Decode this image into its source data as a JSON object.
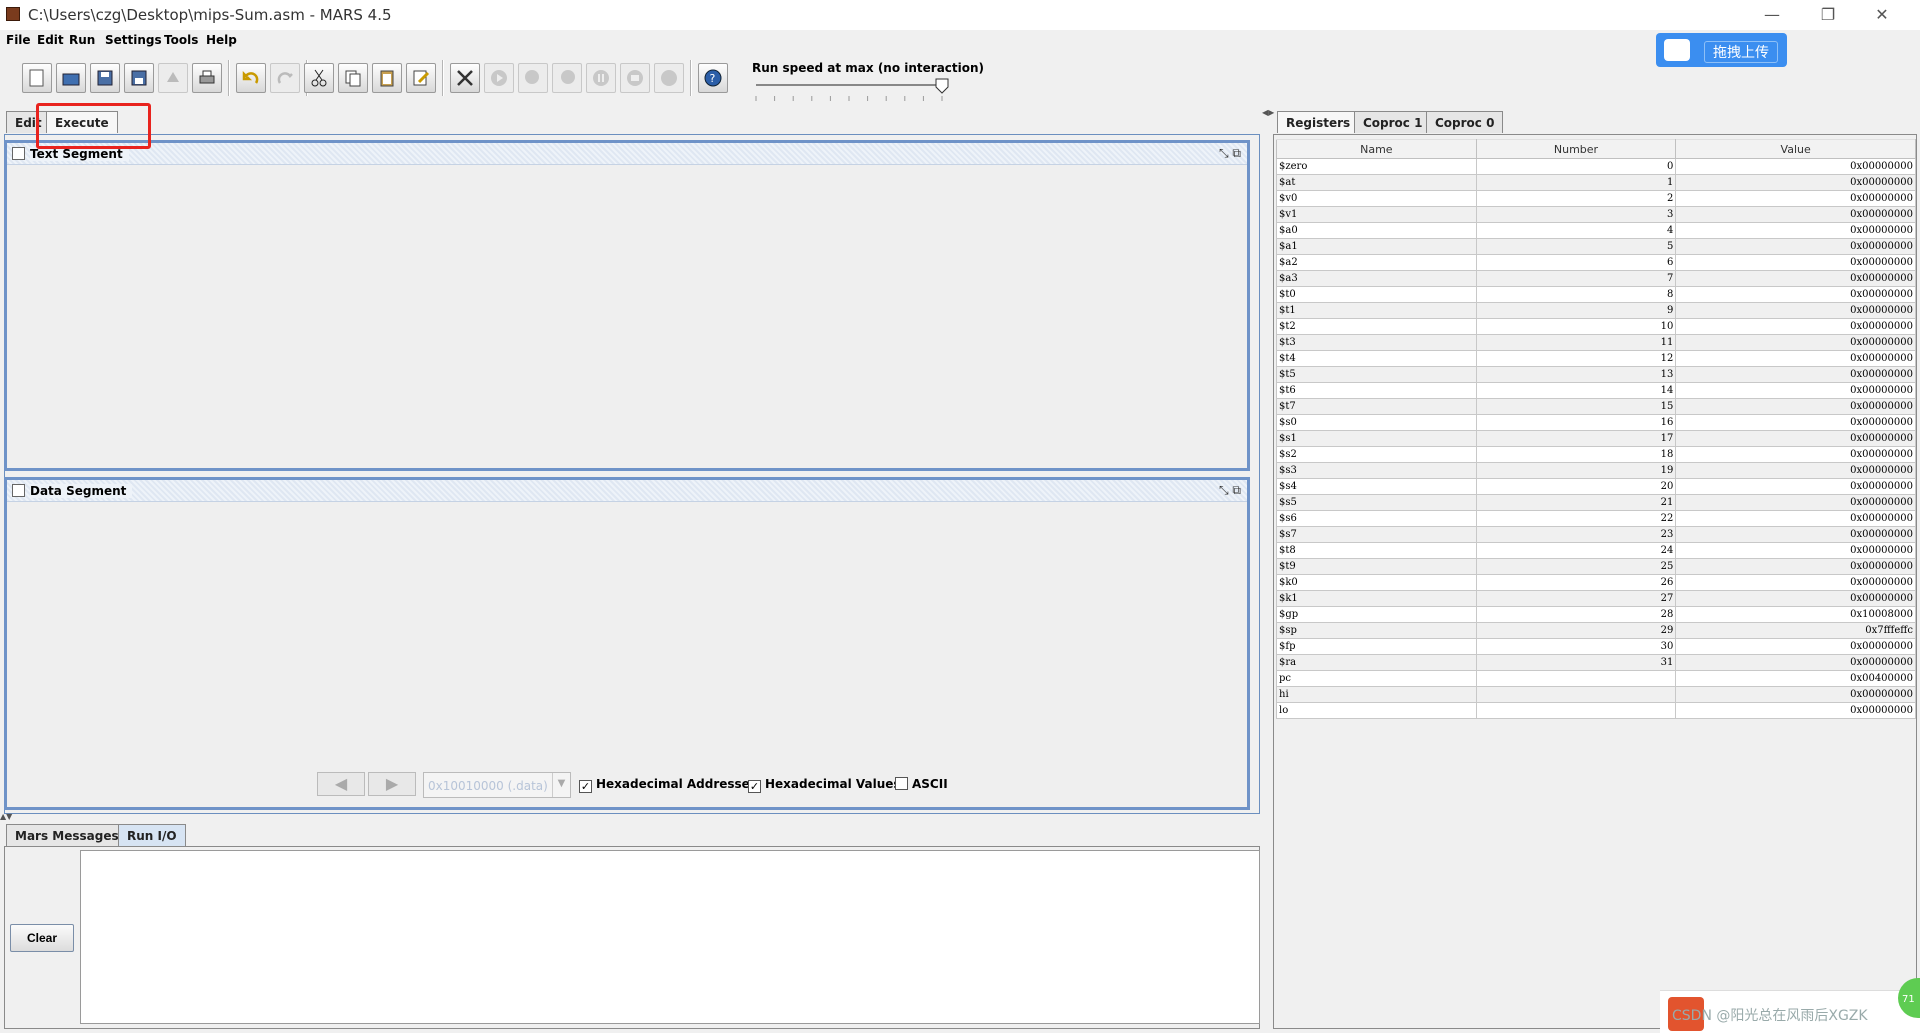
{
  "window": {
    "title": "C:\\Users\\czg\\Desktop\\mips-Sum.asm  - MARS 4.5",
    "min": "—",
    "max": "❐",
    "close": "✕"
  },
  "menu": [
    "File",
    "Edit",
    "Run",
    "Settings",
    "Tools",
    "Help"
  ],
  "toolbar": {
    "speed_label": "Run speed at max (no interaction)",
    "speed_percent": 100
  },
  "upload_button": "拖拽上传",
  "editor_tabs": [
    "Edit",
    "Execute"
  ],
  "text_segment": {
    "title": "Text Segment"
  },
  "data_segment": {
    "title": "Data Segment",
    "address": "0x10010000 (.data)",
    "hex_addresses": "Hexadecimal Addresses",
    "hex_values": "Hexadecimal Values",
    "ascii": "ASCII"
  },
  "message_tabs": [
    "Mars Messages",
    "Run I/O"
  ],
  "clear_label": "Clear",
  "register_tabs": [
    "Registers",
    "Coproc 1",
    "Coproc 0"
  ],
  "register_headers": [
    "Name",
    "Number",
    "Value"
  ],
  "registers": [
    [
      "$zero",
      "0",
      "0x00000000"
    ],
    [
      "$at",
      "1",
      "0x00000000"
    ],
    [
      "$v0",
      "2",
      "0x00000000"
    ],
    [
      "$v1",
      "3",
      "0x00000000"
    ],
    [
      "$a0",
      "4",
      "0x00000000"
    ],
    [
      "$a1",
      "5",
      "0x00000000"
    ],
    [
      "$a2",
      "6",
      "0x00000000"
    ],
    [
      "$a3",
      "7",
      "0x00000000"
    ],
    [
      "$t0",
      "8",
      "0x00000000"
    ],
    [
      "$t1",
      "9",
      "0x00000000"
    ],
    [
      "$t2",
      "10",
      "0x00000000"
    ],
    [
      "$t3",
      "11",
      "0x00000000"
    ],
    [
      "$t4",
      "12",
      "0x00000000"
    ],
    [
      "$t5",
      "13",
      "0x00000000"
    ],
    [
      "$t6",
      "14",
      "0x00000000"
    ],
    [
      "$t7",
      "15",
      "0x00000000"
    ],
    [
      "$s0",
      "16",
      "0x00000000"
    ],
    [
      "$s1",
      "17",
      "0x00000000"
    ],
    [
      "$s2",
      "18",
      "0x00000000"
    ],
    [
      "$s3",
      "19",
      "0x00000000"
    ],
    [
      "$s4",
      "20",
      "0x00000000"
    ],
    [
      "$s5",
      "21",
      "0x00000000"
    ],
    [
      "$s6",
      "22",
      "0x00000000"
    ],
    [
      "$s7",
      "23",
      "0x00000000"
    ],
    [
      "$t8",
      "24",
      "0x00000000"
    ],
    [
      "$t9",
      "25",
      "0x00000000"
    ],
    [
      "$k0",
      "26",
      "0x00000000"
    ],
    [
      "$k1",
      "27",
      "0x00000000"
    ],
    [
      "$gp",
      "28",
      "0x10008000"
    ],
    [
      "$sp",
      "29",
      "0x7fffeffc"
    ],
    [
      "$fp",
      "30",
      "0x00000000"
    ],
    [
      "$ra",
      "31",
      "0x00000000"
    ],
    [
      "pc",
      "",
      "0x00400000"
    ],
    [
      "hi",
      "",
      "0x00000000"
    ],
    [
      "lo",
      "",
      "0x00000000"
    ]
  ],
  "tray_text": "CSDN @阳光总在风雨后XGZK",
  "badge": "71",
  "colors": {
    "highlight": "#e8231e",
    "frame": "#6f93c8",
    "upload": "#3b8ef0"
  }
}
